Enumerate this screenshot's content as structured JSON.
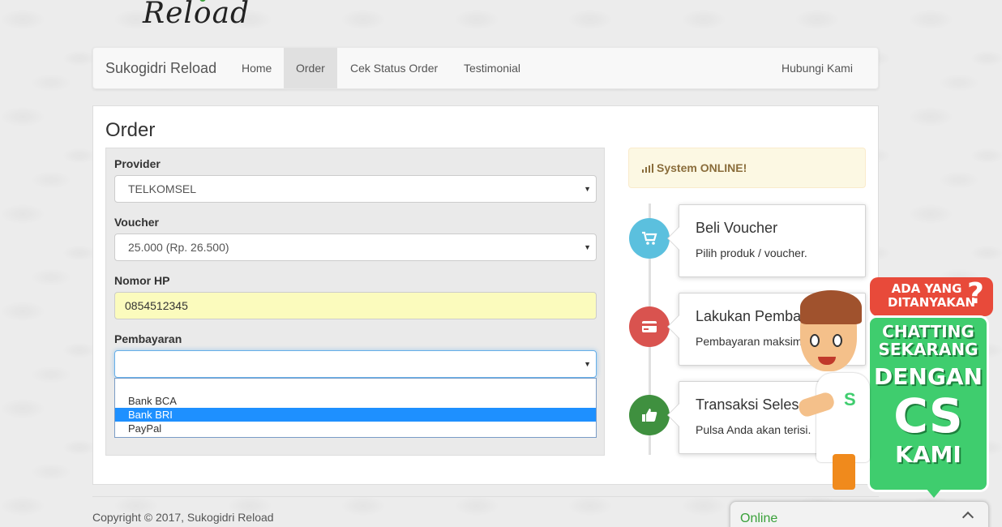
{
  "site": {
    "logo_text": "Reload"
  },
  "navbar": {
    "brand": "Sukogidri Reload",
    "items": [
      {
        "label": "Home",
        "active": false
      },
      {
        "label": "Order",
        "active": true
      },
      {
        "label": "Cek Status Order",
        "active": false
      },
      {
        "label": "Testimonial",
        "active": false
      }
    ],
    "right_item": "Hubungi Kami"
  },
  "page": {
    "title": "Order"
  },
  "form": {
    "provider": {
      "label": "Provider",
      "value": "TELKOMSEL"
    },
    "voucher": {
      "label": "Voucher",
      "value": "25.000 (Rp. 26.500)"
    },
    "phone": {
      "label": "Nomor HP",
      "value": "0854512345"
    },
    "payment": {
      "label": "Pembayaran",
      "value": "",
      "options": [
        "",
        "Bank BCA",
        "Bank BRI",
        "PayPal"
      ],
      "highlighted": "Bank BRI"
    }
  },
  "status_alert": {
    "text": "System ONLINE!",
    "icon": "signal-icon"
  },
  "timeline": [
    {
      "title": "Beli Voucher",
      "body": "Pilih produk / voucher.",
      "icon": "cart-icon",
      "color": "#5bc0de"
    },
    {
      "title": "Lakukan Pembayaran",
      "body": "Pembayaran maksimal",
      "icon": "credit-card-icon",
      "color": "#d9534f"
    },
    {
      "title": "Transaksi Selesai",
      "body": "Pulsa Anda akan terisi.",
      "icon": "thumbs-up-icon",
      "color": "#3f903f"
    }
  ],
  "footer": {
    "copyright": "Copyright © 2017, Sukogidri Reload"
  },
  "chat": {
    "status": "Online",
    "promo": {
      "question": "ADA YANG DITANYAKAN",
      "line1": "CHATTING SEKARANG",
      "line2": "DENGAN",
      "line3": "CS",
      "line4": "KAMI"
    }
  },
  "colors": {
    "accent_green": "#3fcd6e",
    "promo_red": "#e84a3a",
    "select_highlight": "#1e90ff",
    "input_autofill": "#fbfbbd"
  }
}
